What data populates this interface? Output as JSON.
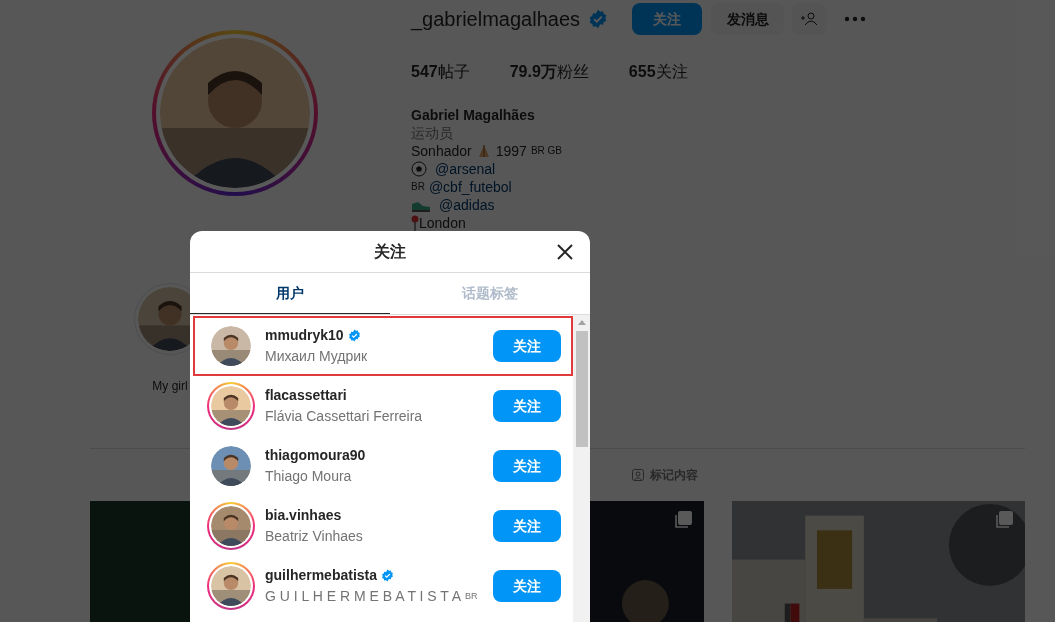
{
  "profile": {
    "username": "_gabrielmagalhaes",
    "verified": true,
    "follow_button": "关注",
    "message_button": "发消息",
    "stats": [
      {
        "value": "547",
        "label": "帖子"
      },
      {
        "value": "79.9",
        "unit": "万",
        "label": "粉丝"
      },
      {
        "value": "655",
        "label": "关注"
      }
    ],
    "name": "Gabriel Magalhães",
    "category": "运动员",
    "bio_lines": [
      {
        "kind": "pray",
        "before": "Sonhador",
        "after": "1997",
        "flags": "BR GB"
      },
      {
        "kind": "ball",
        "text": "@arsenal"
      },
      {
        "kind": "flag",
        "flag": "BR",
        "text": "@cbf_futebol"
      },
      {
        "kind": "shoe",
        "text": "@adidas"
      },
      {
        "kind": "pin",
        "text": "London"
      }
    ]
  },
  "highlights": [
    {
      "label": "My girl"
    }
  ],
  "content_tab": {
    "label": "标记内容"
  },
  "posts": [
    {
      "kind": "picture"
    },
    {
      "kind": "picture",
      "multi": true
    },
    {
      "kind": "picture",
      "multi": true
    }
  ],
  "dialog": {
    "title": "关注",
    "tabs": [
      {
        "label": "用户",
        "selected": true
      },
      {
        "label": "话题标签",
        "selected": false
      }
    ],
    "users": [
      {
        "username": "mmudryk10",
        "full_name": "Михаил Мудрик",
        "verified": true,
        "has_story": false,
        "highlighted": true,
        "button": "关注"
      },
      {
        "username": "flacassettari",
        "full_name": "Flávia Cassettari Ferreira",
        "verified": false,
        "has_story": true,
        "highlighted": false,
        "button": "关注"
      },
      {
        "username": "thiagomoura90",
        "full_name": "Thiago Moura",
        "verified": false,
        "has_story": false,
        "highlighted": false,
        "button": "关注"
      },
      {
        "username": "bia.vinhaes",
        "full_name": "Beatriz Vinhaes",
        "verified": false,
        "has_story": true,
        "highlighted": false,
        "button": "关注"
      },
      {
        "username": "guilhermebatista",
        "full_name": "G U I L H E R M E B A T I S T A",
        "flag": "BR",
        "verified": true,
        "has_story": true,
        "highlighted": false,
        "button": "关注"
      }
    ]
  }
}
